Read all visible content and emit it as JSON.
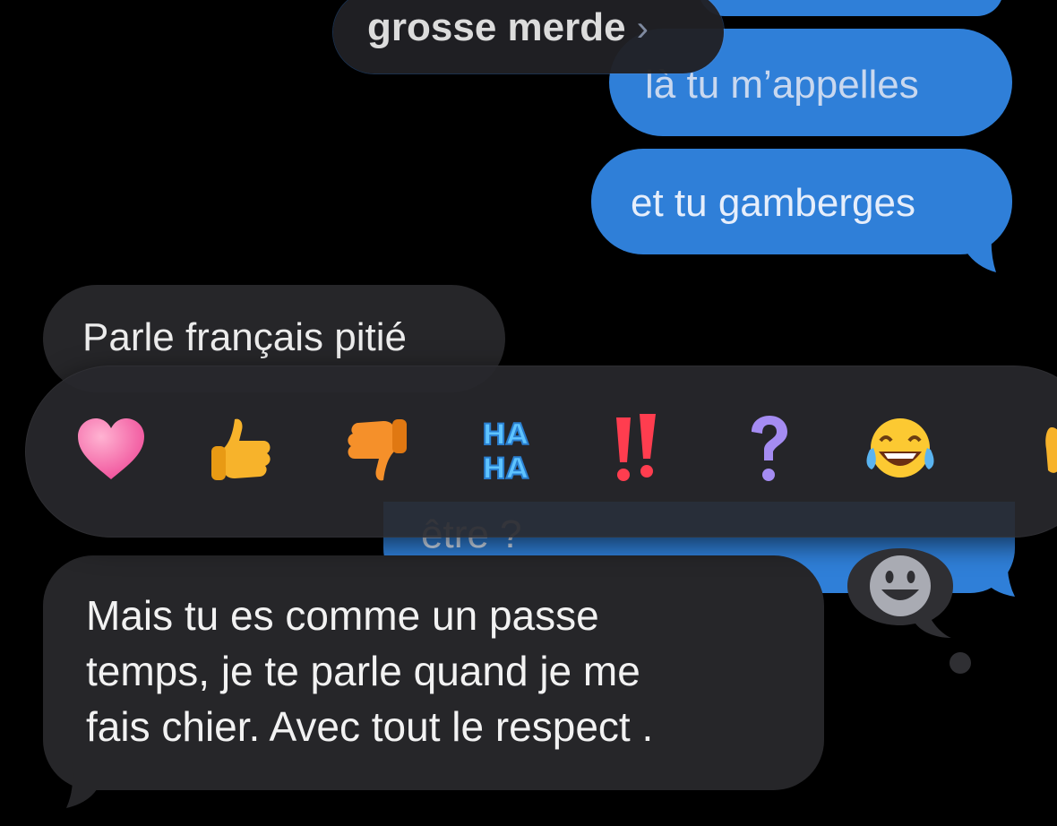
{
  "conversation": {
    "messages": [
      {
        "id": "appelles",
        "side": "sent",
        "text": "là tu m’appelles"
      },
      {
        "id": "gamberges",
        "side": "sent",
        "text": "et tu gamberges"
      },
      {
        "id": "francais",
        "side": "received",
        "text": "Parle français pitié"
      },
      {
        "id": "hidden",
        "side": "sent",
        "text": "être ?"
      },
      {
        "id": "passe",
        "side": "received",
        "lines": [
          "Mais tu es comme un passe",
          "temps, je te parle quand je me",
          "fais chier. Avec tout le respect ."
        ]
      }
    ]
  },
  "pill": {
    "text": "grosse merde",
    "chevron": "›"
  },
  "reactions": [
    {
      "name": "heart",
      "icon": "heart-icon"
    },
    {
      "name": "thumbs-up",
      "icon": "thumbs-up-icon"
    },
    {
      "name": "thumbs-down",
      "icon": "thumbs-down-icon"
    },
    {
      "name": "haha",
      "icon": "haha-icon",
      "top": "HA",
      "bottom": "HA"
    },
    {
      "name": "emphasize",
      "icon": "double-exclamation-icon"
    },
    {
      "name": "question",
      "icon": "question-mark-icon"
    },
    {
      "name": "laugh",
      "icon": "tears-of-joy-icon"
    },
    {
      "name": "more",
      "icon": "partial-emoji-icon"
    }
  ],
  "emoji_picker": {
    "icon": "smiley-face-icon"
  },
  "colors": {
    "background": "#000000",
    "sent_bubble": "#2f7fd8",
    "received_bubble": "#262629",
    "reaction_bar": "#28282c"
  }
}
